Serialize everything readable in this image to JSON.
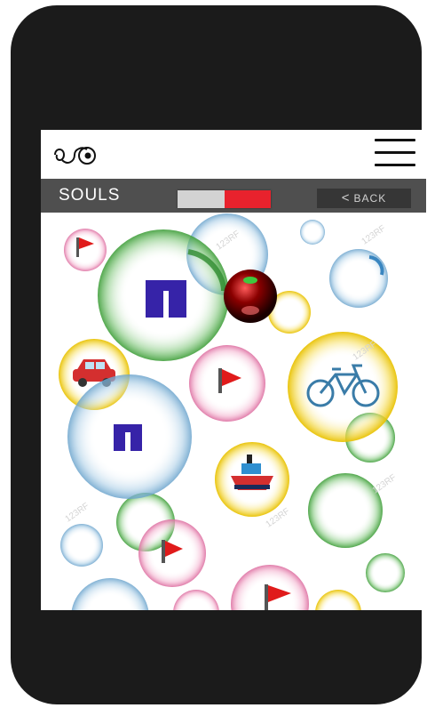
{
  "header": {
    "title": "SOULS",
    "back_label": "BACK",
    "back_chevron": "<"
  },
  "progress": {
    "value": 0.5,
    "track_color": "#d3d3d3",
    "fill_color": "#e8222d"
  },
  "icons": {
    "logo": "swirl-eye-logo-icon",
    "menu": "hamburger-menu-icon",
    "flag": "flag-icon",
    "pants": "pants-icon",
    "car": "car-icon",
    "bicycle": "bicycle-icon",
    "ship": "ship-icon",
    "orb": "dark-orb-icon"
  },
  "colors": {
    "phone_body": "#1b1b1b",
    "navbar": "#4f4f4f",
    "bubble_green": "#4caf50",
    "bubble_blue": "#7fb3d5",
    "bubble_yellow": "#f2d21b",
    "bubble_pink": "#e98ab5"
  },
  "watermark": "123RF"
}
